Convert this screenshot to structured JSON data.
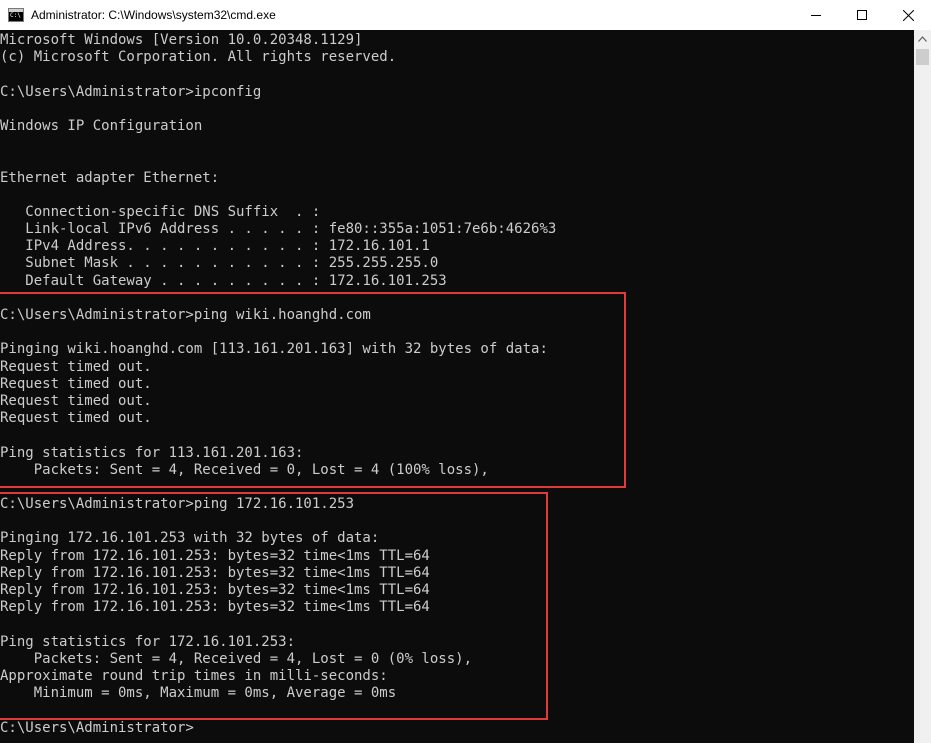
{
  "window": {
    "title": "Administrator: C:\\Windows\\system32\\cmd.exe",
    "icon": "cmd-icon",
    "controls": {
      "minimize_icon": "minimize-icon",
      "maximize_icon": "maximize-icon",
      "close_icon": "close-icon"
    }
  },
  "console": {
    "lines": [
      "Microsoft Windows [Version 10.0.20348.1129]",
      "(c) Microsoft Corporation. All rights reserved.",
      "",
      "C:\\Users\\Administrator>ipconfig",
      "",
      "Windows IP Configuration",
      "",
      "",
      "Ethernet adapter Ethernet:",
      "",
      "   Connection-specific DNS Suffix  . :",
      "   Link-local IPv6 Address . . . . . : fe80::355a:1051:7e6b:4626%3",
      "   IPv4 Address. . . . . . . . . . . : 172.16.101.1",
      "   Subnet Mask . . . . . . . . . . . : 255.255.255.0",
      "   Default Gateway . . . . . . . . . : 172.16.101.253",
      "",
      "C:\\Users\\Administrator>ping wiki.hoanghd.com",
      "",
      "Pinging wiki.hoanghd.com [113.161.201.163] with 32 bytes of data:",
      "Request timed out.",
      "Request timed out.",
      "Request timed out.",
      "Request timed out.",
      "",
      "Ping statistics for 113.161.201.163:",
      "    Packets: Sent = 4, Received = 0, Lost = 4 (100% loss),",
      "",
      "C:\\Users\\Administrator>ping 172.16.101.253",
      "",
      "Pinging 172.16.101.253 with 32 bytes of data:",
      "Reply from 172.16.101.253: bytes=32 time<1ms TTL=64",
      "Reply from 172.16.101.253: bytes=32 time<1ms TTL=64",
      "Reply from 172.16.101.253: bytes=32 time<1ms TTL=64",
      "Reply from 172.16.101.253: bytes=32 time<1ms TTL=64",
      "",
      "Ping statistics for 172.16.101.253:",
      "    Packets: Sent = 4, Received = 4, Lost = 0 (0% loss),",
      "Approximate round trip times in milli-seconds:",
      "    Minimum = 0ms, Maximum = 0ms, Average = 0ms",
      "",
      "C:\\Users\\Administrator>"
    ]
  },
  "colors": {
    "console_background": "#0c0c0c",
    "console_text": "#cccccc",
    "highlight_border": "#e03a3a",
    "titlebar_background": "#ffffff"
  },
  "scrollbar": {
    "up_icon": "chevron-up-icon"
  }
}
